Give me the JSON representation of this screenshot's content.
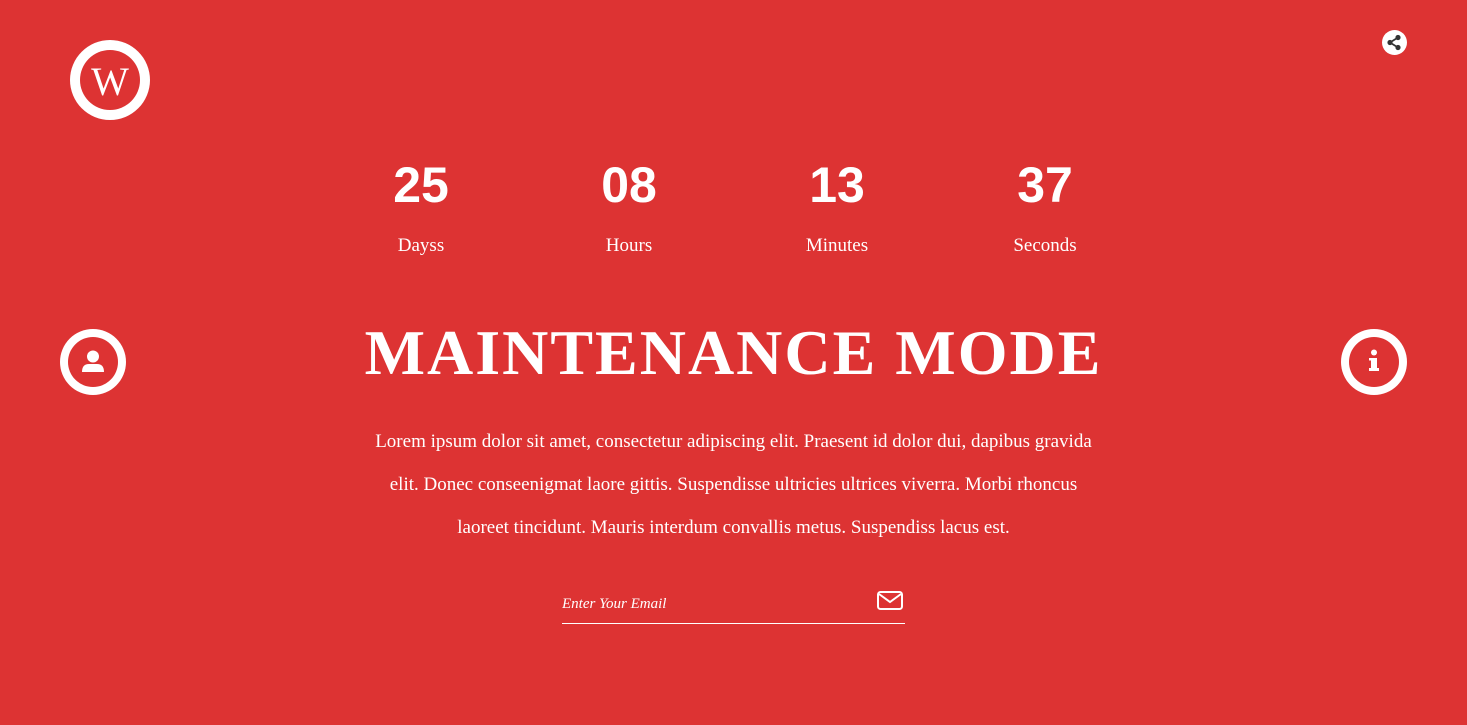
{
  "brand": {
    "logo_icon": "wordpress-icon",
    "logo_letter": "W"
  },
  "header": {
    "share_icon": "share-icon"
  },
  "countdown": [
    {
      "value": "25",
      "label": "Dayss"
    },
    {
      "value": "08",
      "label": "Hours"
    },
    {
      "value": "13",
      "label": "Minutes"
    },
    {
      "value": "37",
      "label": "Seconds"
    }
  ],
  "side": {
    "left_icon": "user-icon",
    "right_icon": "info-icon"
  },
  "main": {
    "title": "MAINTENANCE MODE",
    "description_lines": [
      "Lorem ipsum dolor sit amet, consectetur adipiscing elit. Praesent id dolor dui, dapibus gravida",
      "elit. Donec conseenigmat laore gittis. Suspendisse ultricies ultrices viverra. Morbi rhoncus",
      "laoreet tincidunt. Mauris interdum convallis metus. Suspendiss lacus est."
    ]
  },
  "subscribe": {
    "email_placeholder": "Enter Your Email",
    "email_value": "",
    "submit_icon": "envelope-icon"
  },
  "colors": {
    "background": "#dd3333",
    "foreground": "#ffffff"
  }
}
